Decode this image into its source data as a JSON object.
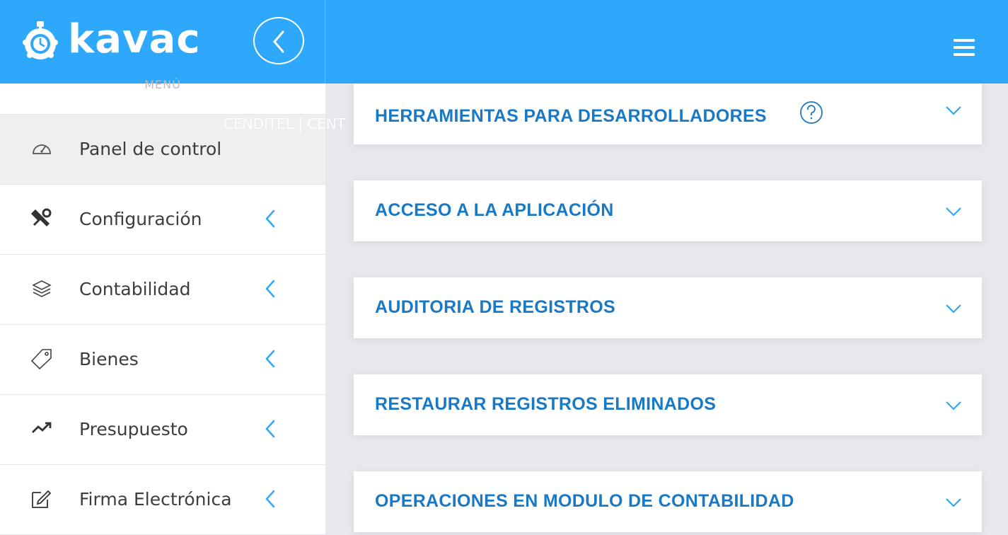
{
  "header": {
    "logo_text": "kavac",
    "logo_icon": "gear-clock-icon",
    "collapse_icon": "chevron-left-icon",
    "menu_icon": "hamburger-icon",
    "bg_color": "#2da8fa"
  },
  "sidebar": {
    "title": "MENÚ",
    "items": [
      {
        "label": "Panel de control",
        "icon": "dashboard-icon",
        "active": true
      },
      {
        "label": "Configuración",
        "icon": "tools-icon",
        "has_submenu": true
      },
      {
        "label": "Contabilidad",
        "icon": "layers-icon",
        "has_submenu": true
      },
      {
        "label": "Bienes",
        "icon": "tag-icon",
        "has_submenu": true
      },
      {
        "label": "Presupuesto",
        "icon": "trending-up-icon",
        "has_submenu": true
      },
      {
        "label": "Firma Electrónica",
        "icon": "edit-icon",
        "has_submenu": true
      }
    ]
  },
  "overlay": {
    "text": "CENDITEL | CENT"
  },
  "main": {
    "cards": [
      {
        "title": "HERRAMIENTAS PARA DESARROLLADORES",
        "has_help": true
      },
      {
        "title": "ACCESO A LA APLICACIÓN"
      },
      {
        "title": "AUDITORIA DE REGISTROS"
      },
      {
        "title": "RESTAURAR REGISTROS ELIMINADOS"
      },
      {
        "title": "OPERACIONES EN MODULO DE CONTABILIDAD"
      }
    ],
    "accent_color": "#1a79c4"
  }
}
